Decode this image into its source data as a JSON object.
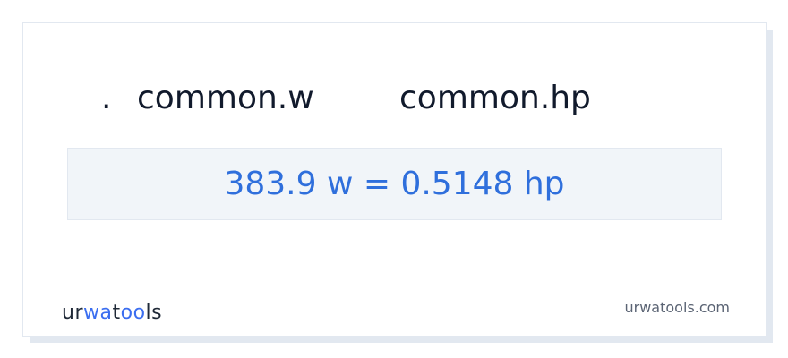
{
  "converter": {
    "separator": ".",
    "from_unit": "common.w",
    "to_unit": "common.hp",
    "result": "383.9 w = 0.5148 hp"
  },
  "footer": {
    "logo_part1": "ur",
    "logo_part2": "wa",
    "logo_part3": "t",
    "logo_part4": "oo",
    "logo_part5": "ls",
    "site": "urwatools.com"
  },
  "colors": {
    "result_text": "#2f6fdc",
    "logo_accent": "#3b6ef0",
    "result_bg": "#f1f5f9"
  }
}
